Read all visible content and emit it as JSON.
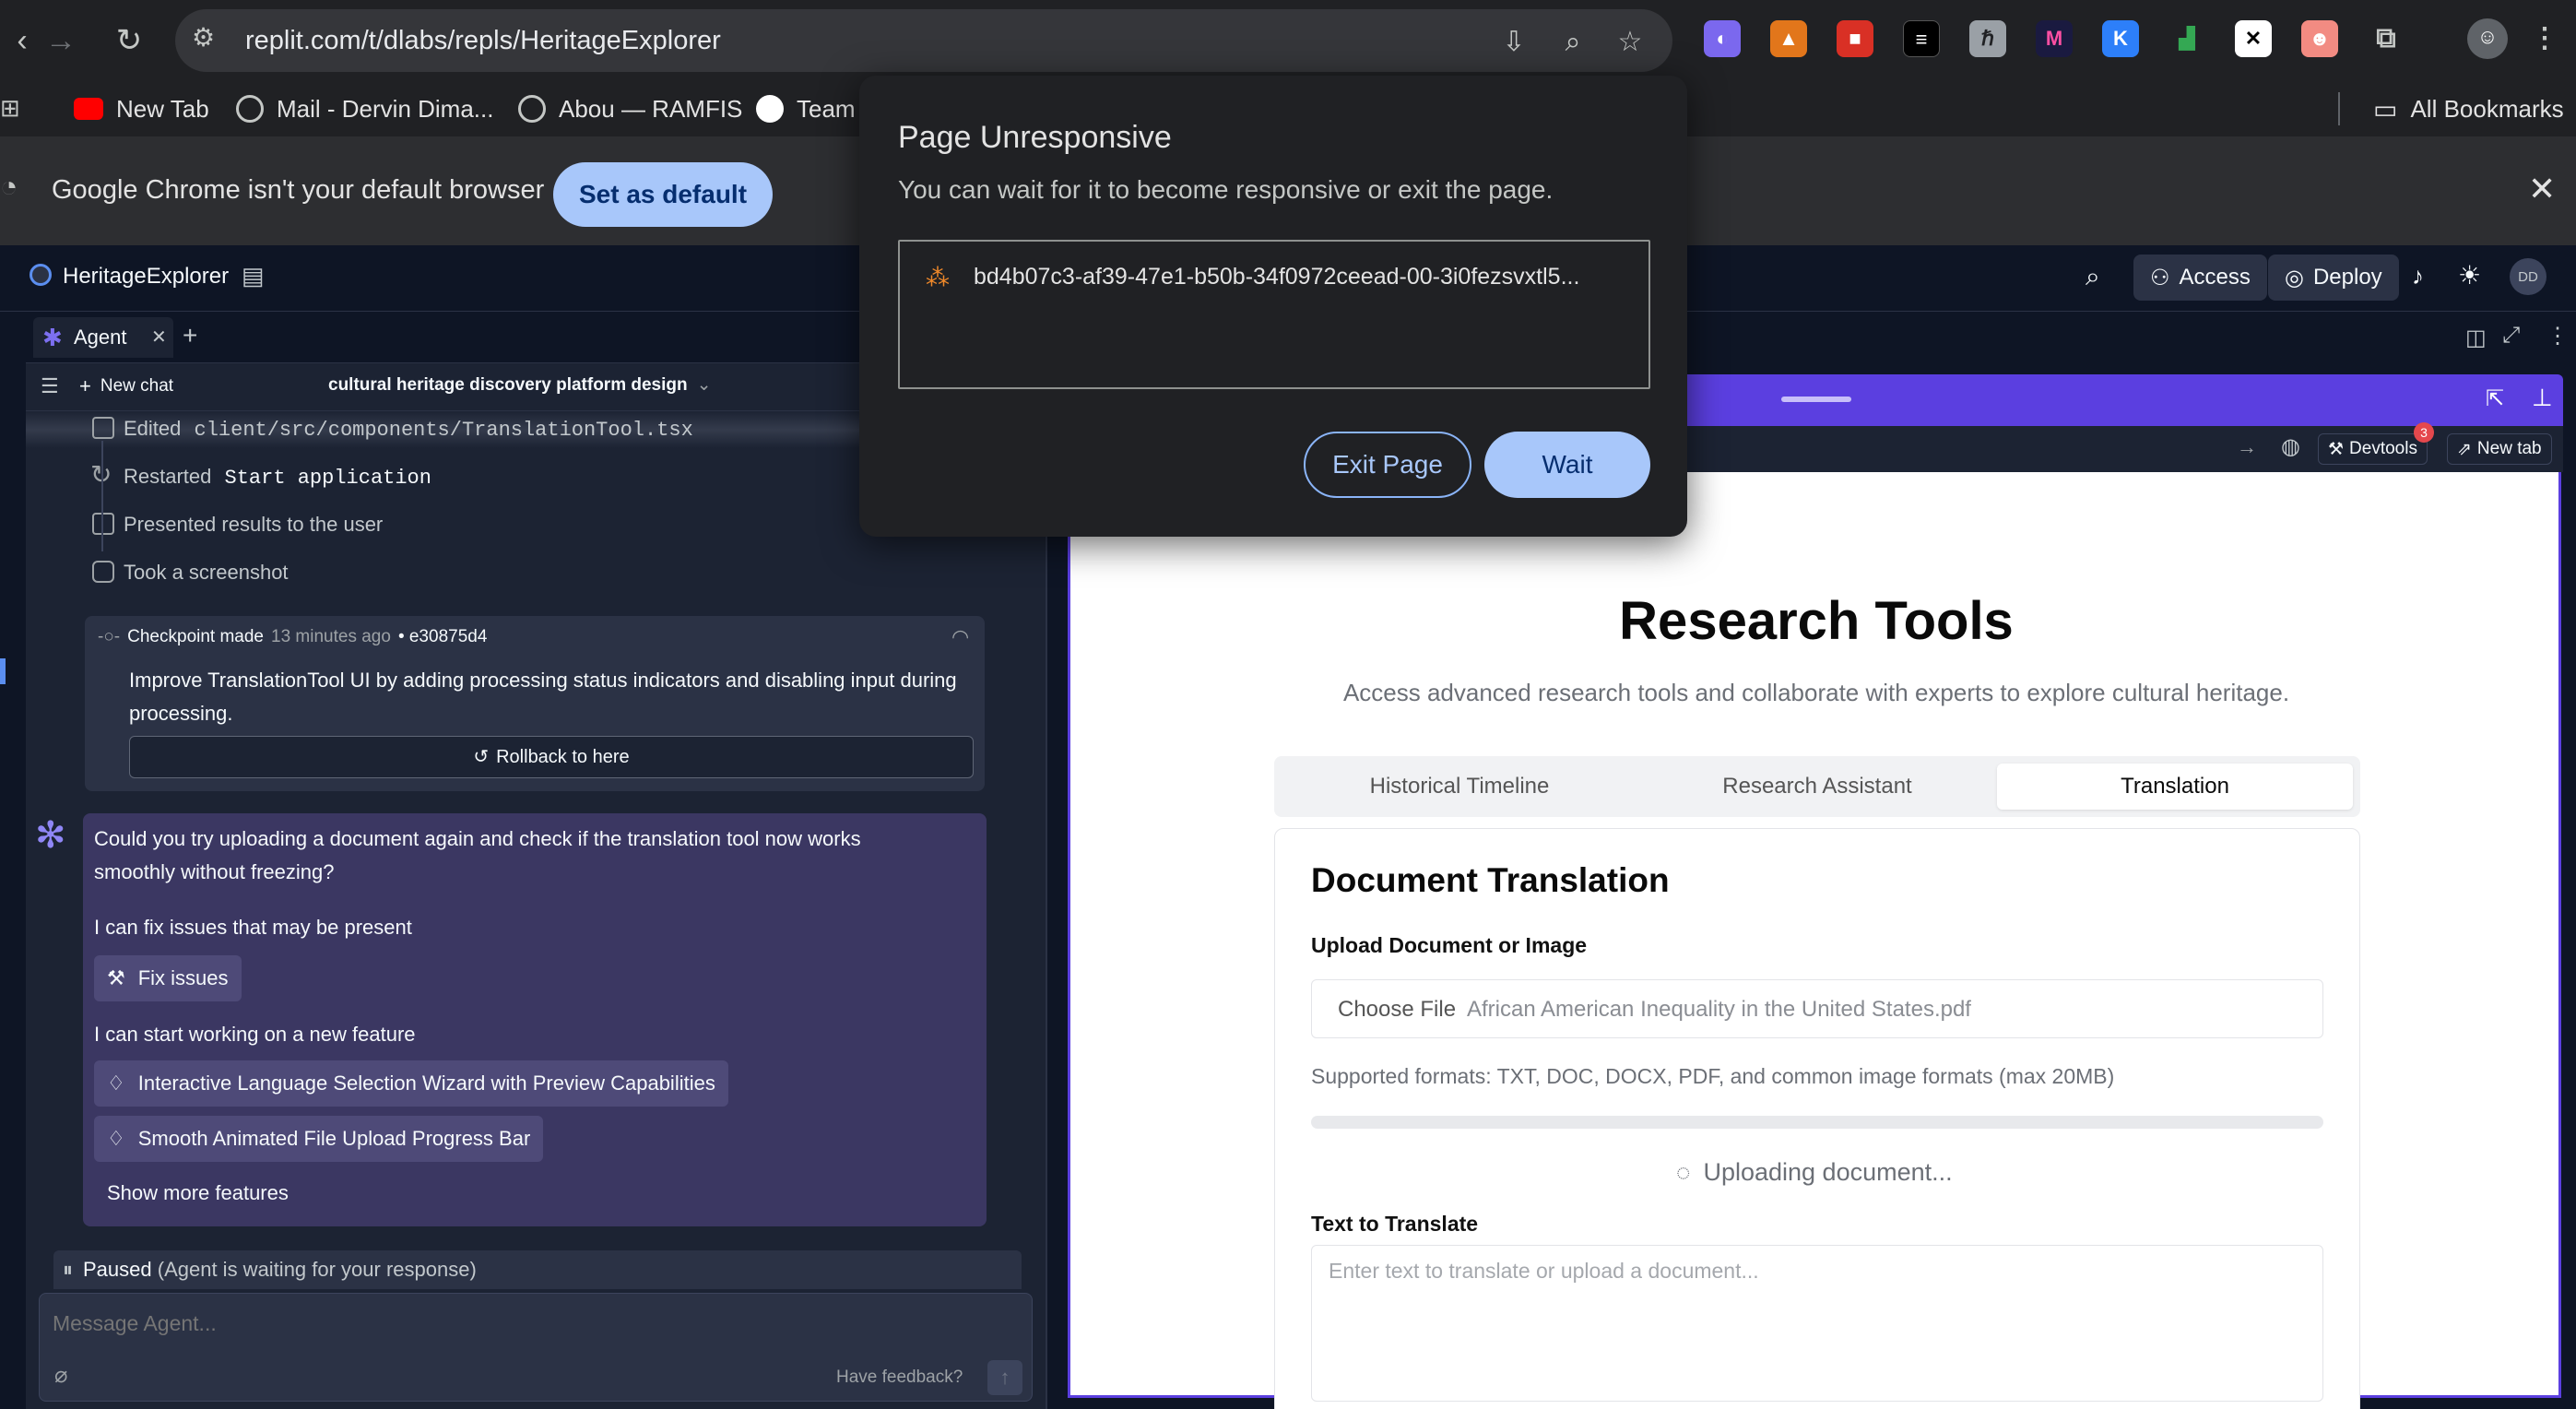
{
  "browser": {
    "url": "replit.com/t/dlabs/repls/HeritageExplorer",
    "bookmarks": [
      "New Tab",
      "Mail - Dervin Dima...",
      "Abou — RAMFIS",
      "Team"
    ],
    "all_bookmarks": "All Bookmarks",
    "default_banner": {
      "message": "Google Chrome isn't your default browser",
      "button": "Set as default"
    }
  },
  "replit": {
    "project_name": "HeritageExplorer",
    "access_label": "Access",
    "deploy_label": "Deploy",
    "avatar_initials": "DD"
  },
  "agent": {
    "tab_label": "Agent",
    "new_chat": "New chat",
    "chat_title": "cultural heritage discovery platform design",
    "steps": [
      {
        "verb": "Edited",
        "detail": "client/src/components/TranslationTool.tsx"
      },
      {
        "verb": "Restarted",
        "detail": "Start application"
      },
      {
        "verb": "Presented results to the user",
        "detail": ""
      },
      {
        "verb": "Took a screenshot",
        "detail": ""
      }
    ],
    "checkpoint": {
      "label": "Checkpoint made",
      "time": "13 minutes ago",
      "hash": "• e30875d4",
      "description": "Improve TranslationTool UI by adding processing status indicators and disabling input during processing.",
      "rollback": "Rollback to here"
    },
    "message": {
      "question_line1": "Could you try uploading a document again and check if the translation tool now works",
      "question_line2": "smoothly without freezing?",
      "fix_intro": "I can fix issues that may be present",
      "fix_button": "Fix issues",
      "feature_intro": "I can start working on a new feature",
      "features": [
        "Interactive Language Selection Wizard with Preview Capabilities",
        "Smooth Animated File Upload Progress Bar"
      ],
      "show_more": "Show more features"
    },
    "paused_label": "Paused",
    "paused_detail": "(Agent is waiting for your response)",
    "input_placeholder": "Message Agent...",
    "feedback": "Have feedback?"
  },
  "preview": {
    "devtools": "Devtools",
    "devtools_badge": "3",
    "new_tab": "New tab",
    "title": "Research Tools",
    "subtitle": "Access advanced research tools and collaborate with experts to explore cultural heritage.",
    "tabs": [
      "Historical Timeline",
      "Research Assistant",
      "Translation"
    ],
    "active_tab": "Translation",
    "doc_title": "Document Translation",
    "upload_label": "Upload Document or Image",
    "choose_file": "Choose File",
    "file_name": "African American Inequality in the United States.pdf",
    "supported": "Supported formats: TXT, DOC, DOCX, PDF, and common image formats (max 20MB)",
    "uploading": "Uploading document...",
    "text_label": "Text to Translate",
    "text_placeholder": "Enter text to translate or upload a document..."
  },
  "dialog": {
    "title": "Page Unresponsive",
    "body": "You can wait for it to become responsive or exit the page.",
    "item": "bd4b07c3-af39-47e1-b50b-34f0972ceead-00-3i0fezsvxtl5...",
    "exit": "Exit Page",
    "wait": "Wait"
  },
  "colors": {
    "accent": "#5b3fe0",
    "chrome_blue": "#a8c7fa",
    "agent_message_bg": "#3b3762"
  }
}
